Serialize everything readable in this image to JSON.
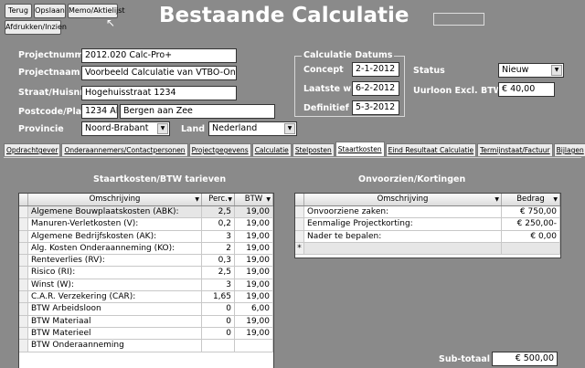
{
  "toolbar": {
    "back_label": "Terug",
    "save_label": "Opslaan",
    "memo_label": "Memo/Aktielijst",
    "print_label": "Afdrukken/Inzien"
  },
  "page_title": "Bestaande Calculatie",
  "project": {
    "number_label": "Projectnummer",
    "number": "2012.020 Calc-Pro+",
    "name_label": "Projectnaam",
    "name": "Voorbeeld Calculatie van VTBO-Ontwikkeling",
    "street_label": "Straat/Huisnr",
    "street": "Hogehuisstraat 1234",
    "postcode_label": "Postcode/Plaats",
    "postcode": "1234 AB",
    "city": "Bergen aan Zee",
    "province_label": "Provincie",
    "province": "Noord-Brabant",
    "country_label": "Land",
    "country": "Nederland"
  },
  "dates": {
    "group_title": "Calculatie Datums",
    "concept_label": "Concept",
    "concept": "2-1-2012",
    "last_label": "Laatste wijz.",
    "last": "6-2-2012",
    "final_label": "Definitief",
    "final": "5-3-2012"
  },
  "status": {
    "label": "Status",
    "value": "Nieuw",
    "rate_label": "Uurloon Excl. BTW",
    "rate": "€ 40,00"
  },
  "tabs": [
    {
      "label": "Opdrachtgever"
    },
    {
      "label": "Onderaannemers/Contactpersonen"
    },
    {
      "label": "Projectgegevens"
    },
    {
      "label": "Calculatie"
    },
    {
      "label": "Stelposten"
    },
    {
      "label": "Staartkosten"
    },
    {
      "label": "Eind Resultaat Calculatie"
    },
    {
      "label": "Termijnstaat/Factuur"
    },
    {
      "label": "Bijlagen"
    }
  ],
  "left": {
    "title": "Staartkosten/BTW tarieven",
    "col_desc": "Omschrijving",
    "col_perc": "Perc.",
    "col_btw": "BTW",
    "rows": [
      {
        "desc": "Algemene Bouwplaatskosten (ABK):",
        "perc": "2,5",
        "btw": "19,00"
      },
      {
        "desc": "Manuren-Verletkosten (V):",
        "perc": "0,2",
        "btw": "19,00"
      },
      {
        "desc": "Algemene Bedrijfskosten (AK):",
        "perc": "3",
        "btw": "19,00"
      },
      {
        "desc": "Alg. Kosten Onderaanneming (KO):",
        "perc": "2",
        "btw": "19,00"
      },
      {
        "desc": "Renteverlies (RV):",
        "perc": "0,3",
        "btw": "19,00"
      },
      {
        "desc": "Risico (RI):",
        "perc": "2,5",
        "btw": "19,00"
      },
      {
        "desc": "Winst (W):",
        "perc": "3",
        "btw": "19,00"
      },
      {
        "desc": "C.A.R. Verzekering (CAR):",
        "perc": "1,65",
        "btw": "19,00"
      },
      {
        "desc": "BTW Arbeidsloon",
        "perc": "0",
        "btw": "6,00"
      },
      {
        "desc": "BTW Materiaal",
        "perc": "0",
        "btw": "19,00"
      },
      {
        "desc": "BTW Materieel",
        "perc": "0",
        "btw": "19,00"
      },
      {
        "desc": "BTW Onderaanneming",
        "perc": "",
        "btw": ""
      }
    ]
  },
  "right": {
    "title": "Onvoorzien/Kortingen",
    "col_desc": "Omschrijving",
    "col_amount": "Bedrag",
    "rows": [
      {
        "desc": "Onvoorziene zaken:",
        "amount": "€ 750,00"
      },
      {
        "desc": "Eenmalige Projectkorting:",
        "amount": "€ 250,00-"
      },
      {
        "desc": "Nader te bepalen:",
        "amount": "€ 0,00"
      }
    ],
    "new_marker": "*",
    "subtotal_label": "Sub-totaal",
    "subtotal": "€ 500,00"
  },
  "colors": {
    "background": "#8a8a8a",
    "highlight_row": "#e6e6e6"
  }
}
